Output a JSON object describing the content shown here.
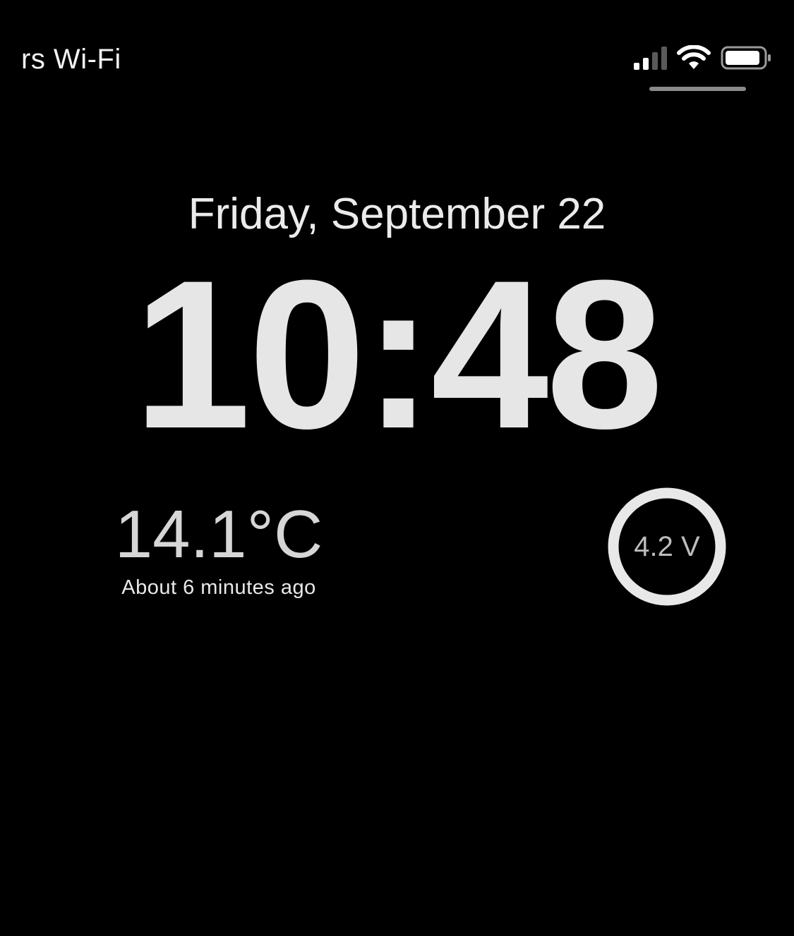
{
  "status_bar": {
    "carrier": "rs Wi-Fi",
    "signal_icon": "cellular-signal-icon",
    "signal_bars_filled": 2,
    "signal_bars_total": 4,
    "wifi_icon": "wifi-icon",
    "battery_icon": "battery-icon",
    "battery_level": 0.85
  },
  "lock_screen": {
    "date": "Friday, September 22",
    "time": "10:48"
  },
  "widgets": {
    "temperature": {
      "value": "14.1°C",
      "updated": "About 6 minutes ago"
    },
    "voltage": {
      "value": "4.2 V",
      "ring_color": "#e8e8e8",
      "icon": "gauge-ring-icon"
    }
  },
  "colors": {
    "background": "#000000",
    "text": "#ececec"
  }
}
